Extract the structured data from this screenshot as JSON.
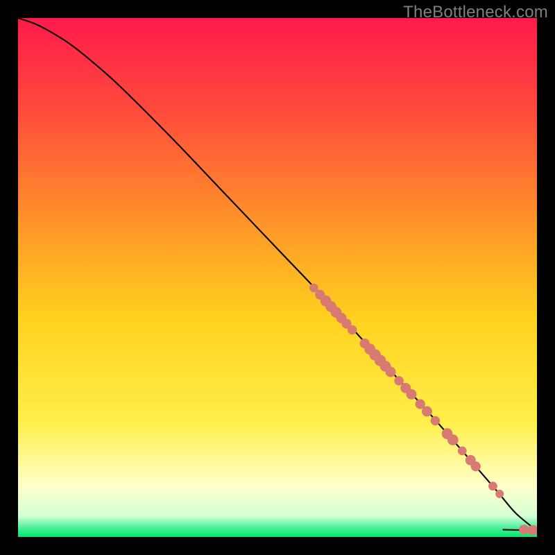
{
  "watermark": "TheBottleneck.com",
  "colors": {
    "bg": "#000000",
    "grad_top": "#ff1a4b",
    "grad_mid_upper": "#ff6a2e",
    "grad_mid": "#ffd21e",
    "grad_mid_lower": "#ffef4a",
    "grad_pale": "#ffffc8",
    "grad_green": "#00e66b",
    "curve": "#000000",
    "dot": "#d87a72"
  },
  "chart_data": {
    "type": "line",
    "title": "",
    "xlabel": "",
    "ylabel": "",
    "xlim": [
      0,
      100
    ],
    "ylim": [
      0,
      100
    ],
    "curve": {
      "comment": "Monotone descending bottleneck curve; values in percent of plot area (0=left/bottom, 100=right/top)",
      "x": [
        0,
        3,
        6,
        10,
        15,
        20,
        30,
        40,
        50,
        60,
        70,
        80,
        90,
        93,
        96,
        100
      ],
      "y": [
        100,
        99,
        97.5,
        95,
        91,
        86.5,
        76.5,
        66,
        55.5,
        45,
        34,
        23,
        11.5,
        8,
        4.5,
        1.2
      ]
    },
    "tail": {
      "comment": "Short near-horizontal segment at bottom-right before final dots",
      "x": [
        93.5,
        98.5
      ],
      "y": [
        1.4,
        1.3
      ]
    },
    "series": [
      {
        "name": "highlighted-points",
        "comment": "Salmon dots along lower-right of curve; r is radius in plot-percent",
        "points": [
          {
            "x": 57.0,
            "y": 48.0,
            "r": 0.85
          },
          {
            "x": 58.2,
            "y": 46.7,
            "r": 0.95
          },
          {
            "x": 59.3,
            "y": 45.5,
            "r": 1.05
          },
          {
            "x": 60.3,
            "y": 44.4,
            "r": 1.05
          },
          {
            "x": 61.3,
            "y": 43.3,
            "r": 1.05
          },
          {
            "x": 62.3,
            "y": 42.2,
            "r": 1.0
          },
          {
            "x": 63.3,
            "y": 41.1,
            "r": 0.95
          },
          {
            "x": 64.4,
            "y": 39.9,
            "r": 0.9
          },
          {
            "x": 66.8,
            "y": 37.3,
            "r": 0.95
          },
          {
            "x": 67.8,
            "y": 36.2,
            "r": 1.05
          },
          {
            "x": 68.8,
            "y": 35.1,
            "r": 1.1
          },
          {
            "x": 69.8,
            "y": 34.0,
            "r": 1.1
          },
          {
            "x": 70.8,
            "y": 32.9,
            "r": 1.05
          },
          {
            "x": 71.8,
            "y": 31.8,
            "r": 1.0
          },
          {
            "x": 73.4,
            "y": 30.1,
            "r": 0.9
          },
          {
            "x": 74.7,
            "y": 28.7,
            "r": 1.0
          },
          {
            "x": 75.8,
            "y": 27.5,
            "r": 1.0
          },
          {
            "x": 77.5,
            "y": 25.6,
            "r": 0.95
          },
          {
            "x": 78.8,
            "y": 24.2,
            "r": 1.0
          },
          {
            "x": 80.4,
            "y": 22.4,
            "r": 0.9
          },
          {
            "x": 82.7,
            "y": 19.9,
            "r": 1.05
          },
          {
            "x": 83.8,
            "y": 18.7,
            "r": 1.05
          },
          {
            "x": 85.6,
            "y": 16.6,
            "r": 0.85
          },
          {
            "x": 87.2,
            "y": 14.8,
            "r": 1.0
          },
          {
            "x": 88.2,
            "y": 13.6,
            "r": 0.95
          },
          {
            "x": 91.5,
            "y": 9.8,
            "r": 0.85
          },
          {
            "x": 92.8,
            "y": 8.3,
            "r": 0.8
          },
          {
            "x": 97.5,
            "y": 1.4,
            "r": 0.95
          },
          {
            "x": 99.2,
            "y": 1.3,
            "r": 1.0
          }
        ]
      }
    ]
  }
}
